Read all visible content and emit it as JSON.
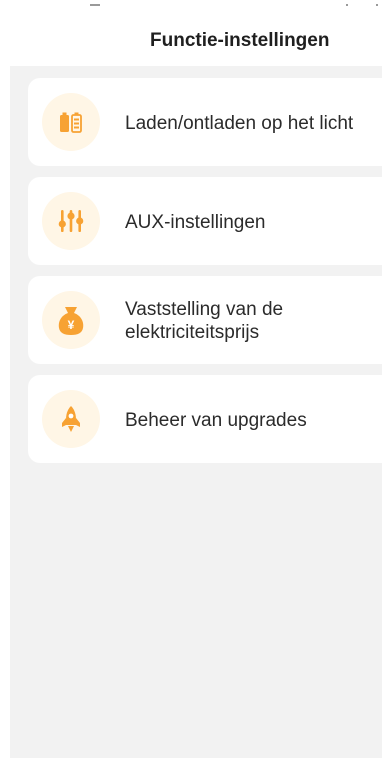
{
  "header": {
    "title": "Functie-instellingen"
  },
  "colors": {
    "accent": "#f7a233",
    "icon_bg": "#fff6e6",
    "page_bg": "#f2f2f2",
    "card_bg": "#ffffff"
  },
  "menu": {
    "items": [
      {
        "label": "Laden/ontladen op het licht",
        "icon": "battery-charge-icon"
      },
      {
        "label": "AUX-instellingen",
        "icon": "sliders-icon"
      },
      {
        "label": "Vaststelling van de\nelektriciteitsprijs",
        "icon": "money-bag-icon"
      },
      {
        "label": "Beheer van upgrades",
        "icon": "rocket-icon"
      }
    ]
  }
}
